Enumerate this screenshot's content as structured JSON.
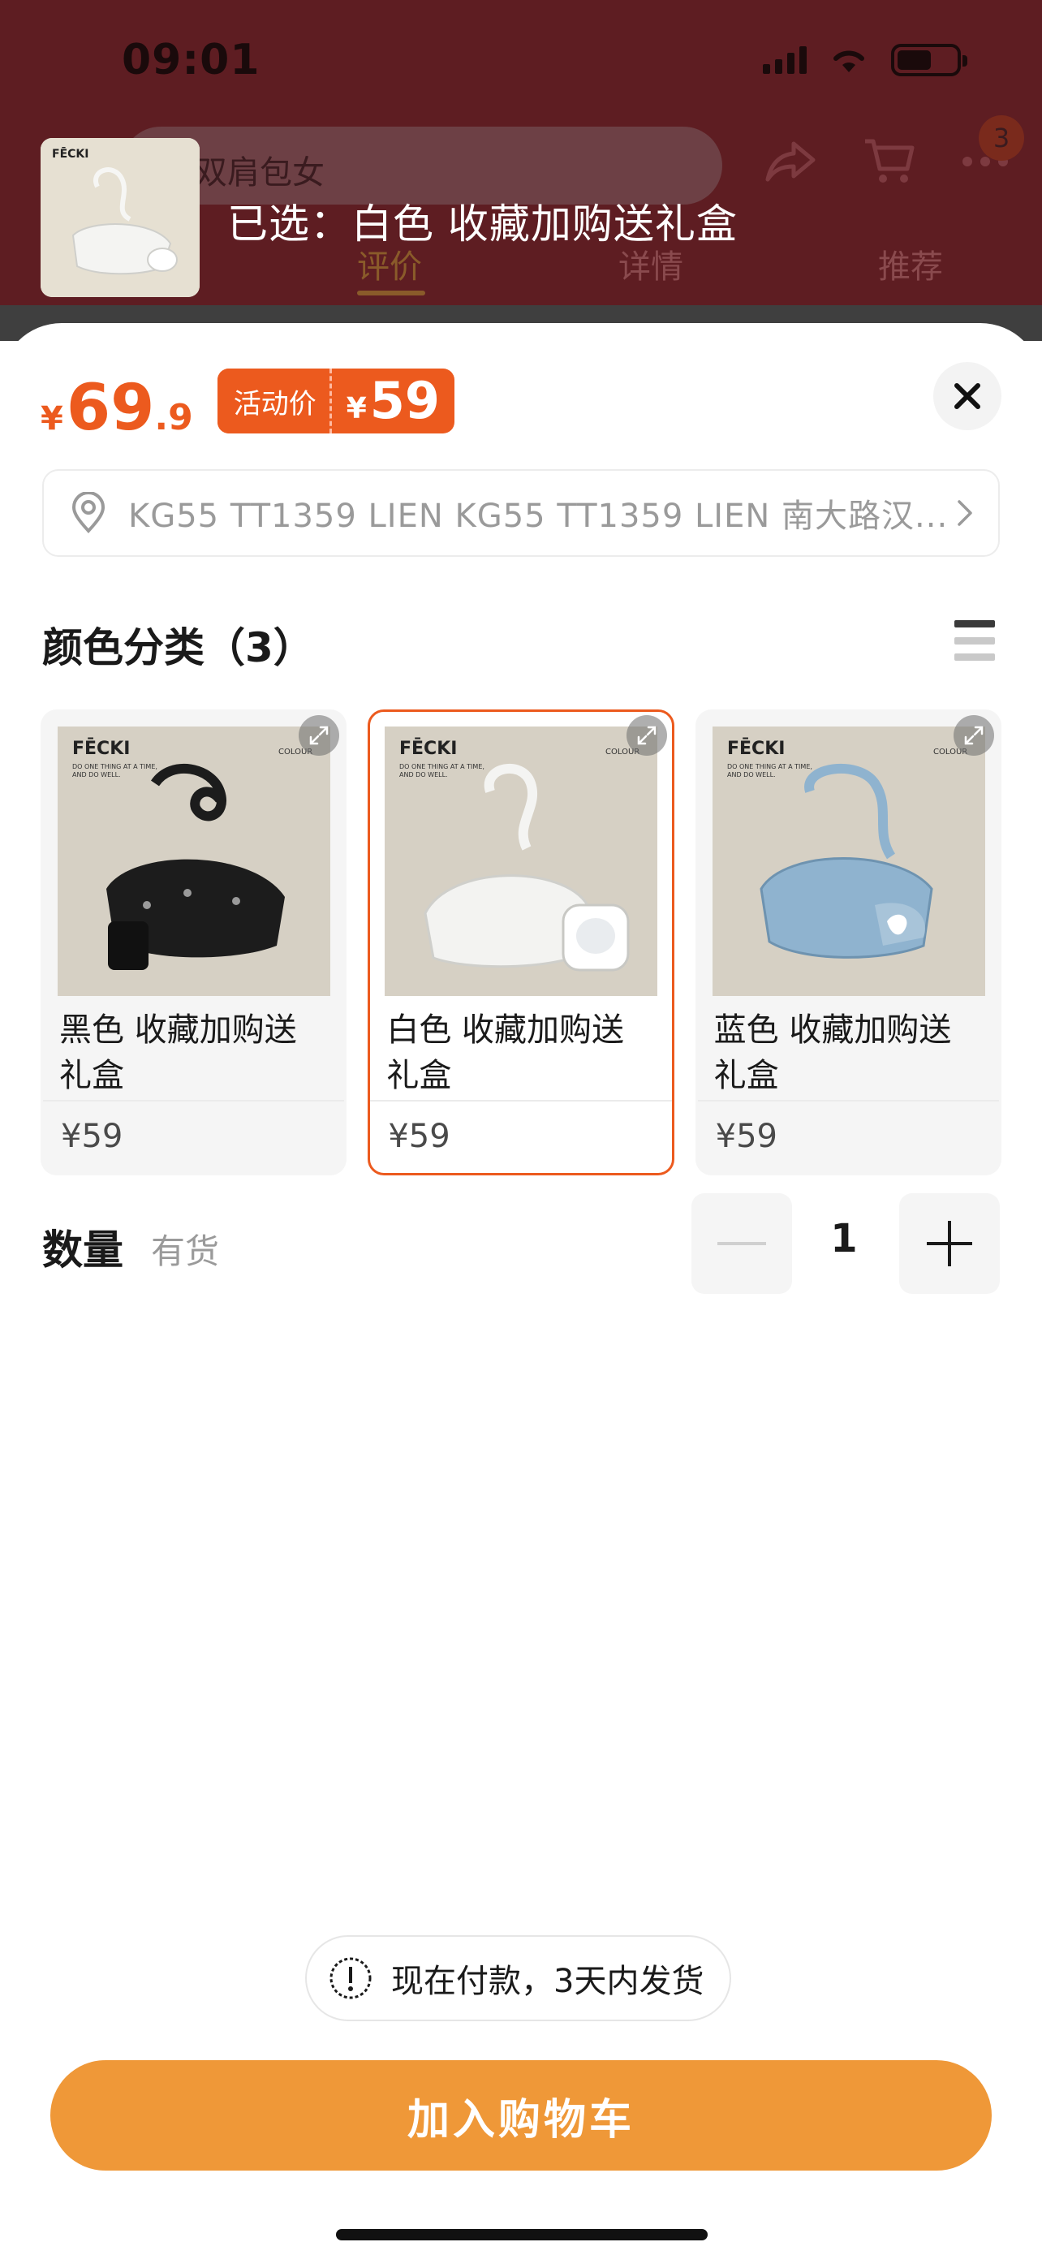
{
  "status_bar": {
    "time": "09:01"
  },
  "background_page": {
    "search_placeholder": "双肩包女",
    "cart_badge": "3",
    "tabs": [
      "评价",
      "详情",
      "推荐"
    ],
    "active_tab": "评价"
  },
  "selection_header": {
    "text": "已选：白色 收藏加购送礼盒",
    "brand": "FĒCKI"
  },
  "price": {
    "currency": "¥",
    "integer": "69",
    "decimal": ".9",
    "promo_label": "活动价",
    "promo_currency": "¥",
    "promo_amount": "59"
  },
  "address": {
    "text": "KG55 TT1359 LIEN KG55 TT1359 LIEN 南大路汉..."
  },
  "color_section": {
    "title": "颜色分类（3）"
  },
  "variants": [
    {
      "name": "黑色 收藏加购送礼盒",
      "price": "¥59",
      "color": "#1c1c1c",
      "selected": false
    },
    {
      "name": "白色 收藏加购送礼盒",
      "price": "¥59",
      "color": "#f2f2f0",
      "selected": true
    },
    {
      "name": "蓝色 收藏加购送礼盒",
      "price": "¥59",
      "color": "#8fb3cf",
      "selected": false
    }
  ],
  "quantity": {
    "label": "数量",
    "stock": "有货",
    "value": "1"
  },
  "shipping_tip": {
    "text": "现在付款，3天内发货"
  },
  "actions": {
    "add_to_cart": "加入购物车"
  },
  "colors": {
    "accent": "#ec5a1e",
    "cart_button": "#ef9838",
    "overlay_bg": "#5e1d22"
  }
}
